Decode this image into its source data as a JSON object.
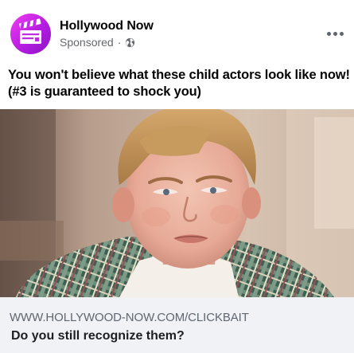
{
  "post": {
    "page_name": "Hollywood Now",
    "sponsored_label": "Sponsored",
    "separator": "·",
    "audience_icon": "globe-icon",
    "avatar_icon": "clapperboard-icon",
    "more_icon": "more-options-icon",
    "text": "You won't believe what these child actors look like now! (#3 is guaranteed to shock you)"
  },
  "link_preview": {
    "domain": "WWW.HOLLYWOOD-NOW.COM/CLICKBAIT",
    "headline": "Do you still recognize them?"
  },
  "colors": {
    "avatar_gradient_start": "#f43df2",
    "avatar_gradient_end": "#8a16c4",
    "secondary_text": "#65676b",
    "preview_background": "#f0f2f5"
  }
}
